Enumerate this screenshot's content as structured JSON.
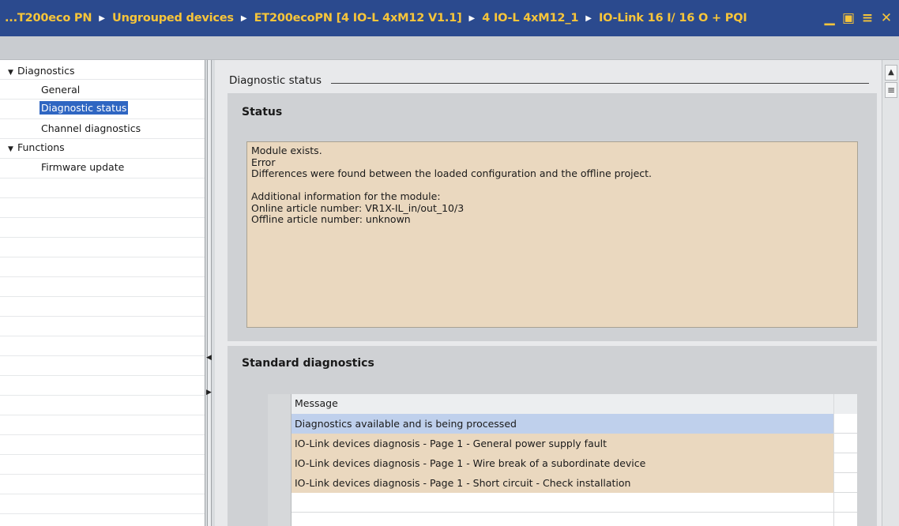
{
  "titlebar": {
    "breadcrumbs": [
      "...T200eco PN",
      "Ungrouped devices",
      "ET200ecoPN [4 IO-L 4xM12 V1.1]",
      "4 IO-L 4xM12_1",
      "IO-Link 16 I/ 16 O + PQI"
    ],
    "controls": {
      "minimize": "▁",
      "float": "▣",
      "maximize": "≡",
      "close": "✕"
    }
  },
  "nav": {
    "items": [
      {
        "label": "Diagnostics",
        "level": 0,
        "expanded": true
      },
      {
        "label": "General",
        "level": 1
      },
      {
        "label": "Diagnostic status",
        "level": 1,
        "selected": true
      },
      {
        "label": "Channel diagnostics",
        "level": 1
      },
      {
        "label": "Functions",
        "level": 0,
        "expanded": true
      },
      {
        "label": "Firmware update",
        "level": 1
      }
    ]
  },
  "main": {
    "section_title": "Diagnostic status",
    "status_panel": {
      "title": "Status",
      "lines": [
        "Module exists.",
        "Error",
        "Differences were found between the loaded configuration and the offline project.",
        "",
        "Additional information for the module:",
        "Online article number:  VR1X-IL_in/out_10/3",
        "Offline article number:  unknown"
      ]
    },
    "standard_panel": {
      "title": "Standard diagnostics",
      "column_header": "Message",
      "rows": [
        {
          "message": "Diagnostics available and is being processed",
          "style": "highlight"
        },
        {
          "message": "IO-Link devices diagnosis - Page 1 - General power supply fault",
          "style": "warning"
        },
        {
          "message": "IO-Link devices diagnosis - Page 1 - Wire break of a subordinate device",
          "style": "warning"
        },
        {
          "message": "IO-Link devices diagnosis - Page 1 - Short circuit - Check installation",
          "style": "warning"
        }
      ],
      "empty_rows": 2
    }
  },
  "colors": {
    "titlebar_bg": "#2b4a8e",
    "titlebar_text": "#f7c53a",
    "selection": "#2f66c2",
    "status_bg": "#ead8bf",
    "row_highlight": "#bfd0ec"
  }
}
